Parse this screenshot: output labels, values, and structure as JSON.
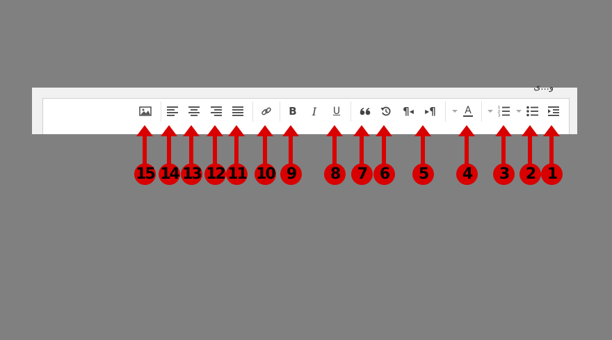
{
  "frame": {
    "corner_text": "و...ى"
  },
  "toolbar": {
    "buttons": [
      {
        "name": "insert-image-button",
        "icon": "image-icon"
      },
      {
        "name": "align-left-button",
        "icon": "align-left-icon"
      },
      {
        "name": "align-center-button",
        "icon": "align-center-icon"
      },
      {
        "name": "align-right-button",
        "icon": "align-right-icon"
      },
      {
        "name": "align-justify-button",
        "icon": "align-justify-icon"
      },
      {
        "name": "link-button",
        "icon": "link-icon"
      },
      {
        "name": "bold-button",
        "icon": "bold-icon",
        "label": "B"
      },
      {
        "name": "italic-button",
        "icon": "italic-icon",
        "label": "I"
      },
      {
        "name": "underline-button",
        "icon": "underline-icon",
        "label": "U"
      },
      {
        "name": "blockquote-button",
        "icon": "quote-icon"
      },
      {
        "name": "undo-button",
        "icon": "undo-icon"
      },
      {
        "name": "rtl-button",
        "icon": "paragraph-rtl-icon",
        "label": "¶"
      },
      {
        "name": "ltr-button",
        "icon": "paragraph-ltr-icon",
        "label": "¶"
      },
      {
        "name": "text-color-button",
        "icon": "text-color-icon",
        "label": "A"
      },
      {
        "name": "ordered-list-button",
        "icon": "numbered-list-icon"
      },
      {
        "name": "bullet-list-button",
        "icon": "bullet-list-icon"
      },
      {
        "name": "indent-button",
        "icon": "indent-icon"
      }
    ]
  },
  "annotations": {
    "accent_color": "#d80000",
    "labels": [
      "15",
      "14",
      "13",
      "12",
      "11",
      "10",
      "9",
      "8",
      "7",
      "6",
      "5",
      "4",
      "3",
      "2",
      "1"
    ]
  }
}
